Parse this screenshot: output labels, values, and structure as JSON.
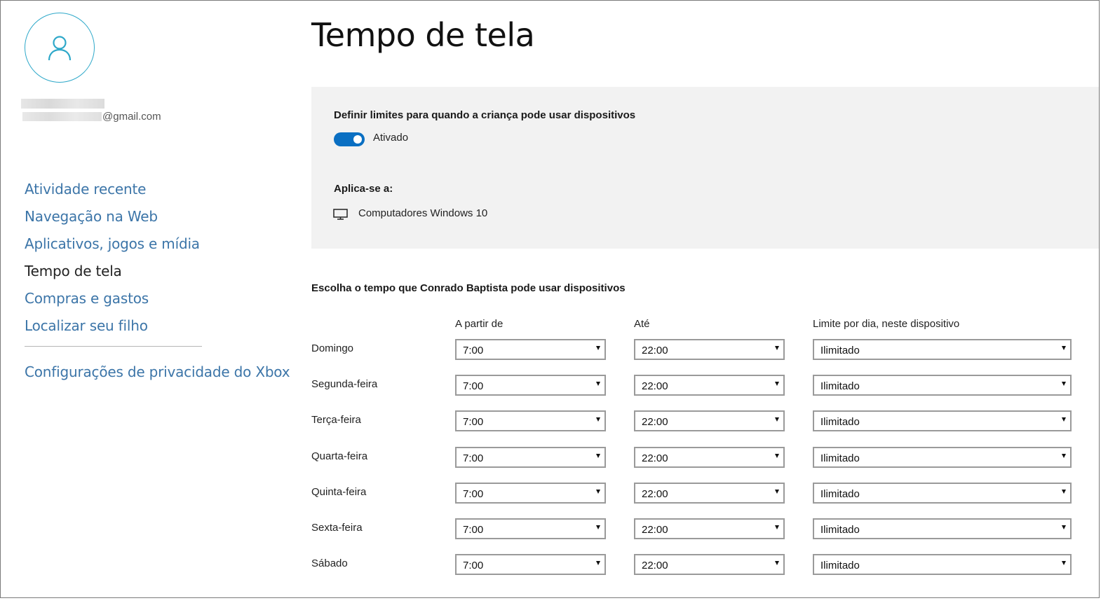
{
  "profile": {
    "email_suffix": "@gmail.com",
    "avatar_icon": "person-icon"
  },
  "sidebar": {
    "items": [
      {
        "label": "Atividade recente",
        "active": false
      },
      {
        "label": "Navegação na Web",
        "active": false
      },
      {
        "label": "Aplicativos, jogos e mídia",
        "active": false
      },
      {
        "label": "Tempo de tela",
        "active": true
      },
      {
        "label": "Compras e gastos",
        "active": false
      },
      {
        "label": "Localizar seu filho",
        "active": false
      }
    ],
    "xbox_privacy": "Configurações de privacidade do Xbox"
  },
  "main": {
    "title": "Tempo de tela",
    "limits_panel": {
      "heading": "Definir limites para quando a criança pode usar dispositivos",
      "toggle_state": "Ativado",
      "applies_label": "Aplica-se a:",
      "device_icon": "monitor-icon",
      "device": "Computadores Windows 10"
    },
    "schedule": {
      "heading": "Escolha o tempo que Conrado Baptista pode usar dispositivos",
      "columns": {
        "from": "A partir de",
        "to": "Até",
        "limit": "Limite por dia, neste dispositivo"
      },
      "days": [
        {
          "day": "Domingo",
          "from": "7:00",
          "to": "22:00",
          "limit": "Ilimitado"
        },
        {
          "day": "Segunda-feira",
          "from": "7:00",
          "to": "22:00",
          "limit": "Ilimitado"
        },
        {
          "day": "Terça-feira",
          "from": "7:00",
          "to": "22:00",
          "limit": "Ilimitado"
        },
        {
          "day": "Quarta-feira",
          "from": "7:00",
          "to": "22:00",
          "limit": "Ilimitado"
        },
        {
          "day": "Quinta-feira",
          "from": "7:00",
          "to": "22:00",
          "limit": "Ilimitado"
        },
        {
          "day": "Sexta-feira",
          "from": "7:00",
          "to": "22:00",
          "limit": "Ilimitado"
        },
        {
          "day": "Sábado",
          "from": "7:00",
          "to": "22:00",
          "limit": "Ilimitado"
        }
      ]
    }
  },
  "colors": {
    "accent": "#0a6fc2",
    "link": "#3c75a8",
    "avatar_ring": "#2ea8c9",
    "panel_bg": "#f2f2f2"
  }
}
